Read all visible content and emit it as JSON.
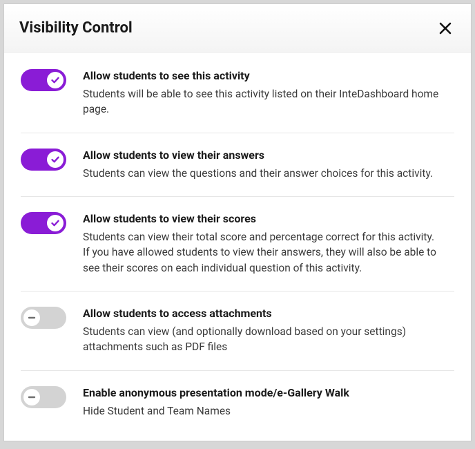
{
  "dialog": {
    "title": "Visibility Control"
  },
  "settings": [
    {
      "on": true,
      "id": "see-activity",
      "title": "Allow students to see this activity",
      "desc": "Students will be able to see this activity listed on their InteDashboard home page."
    },
    {
      "on": true,
      "id": "view-answers",
      "title": "Allow students to view their answers",
      "desc": "Students can view the questions and their answer choices for this activity."
    },
    {
      "on": true,
      "id": "view-scores",
      "title": "Allow students to view their scores",
      "desc": "Students can view their total score and percentage correct for this activity. If you have allowed students to view their answers, they will also be able to see their scores on each individual question of this activity."
    },
    {
      "on": false,
      "id": "access-attachments",
      "title": "Allow students to access attachments",
      "desc": "Students can view (and optionally download based on your settings) attachments such as PDF files"
    },
    {
      "on": false,
      "id": "anonymous-mode",
      "title": "Enable anonymous presentation mode/e-Gallery Walk",
      "desc": "Hide Student and Team Names"
    }
  ]
}
